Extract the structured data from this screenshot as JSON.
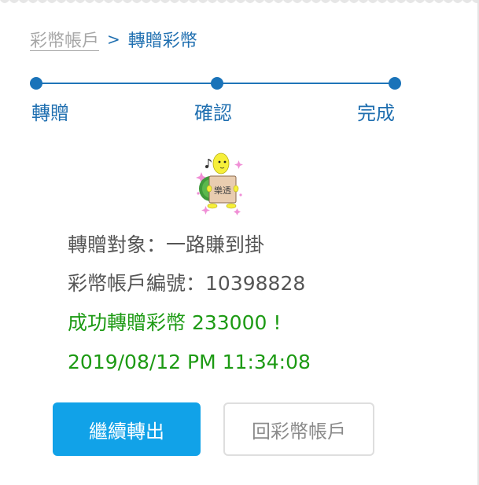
{
  "breadcrumb": {
    "parent": "彩幣帳戶",
    "separator": ">",
    "current": "轉贈彩幣"
  },
  "stepper": {
    "steps": [
      {
        "label": "轉贈"
      },
      {
        "label": "確認"
      },
      {
        "label": "完成"
      }
    ],
    "current_step": 3,
    "color": "#1a73b9"
  },
  "sticker": {
    "icon": "turtle-holding-sign-sticker",
    "sign_text": "樂透"
  },
  "result": {
    "recipient_label": "轉贈對象：",
    "recipient_name": "一路賺到掛",
    "account_label": "彩幣帳戶編號：",
    "account_number": "10398828",
    "success_message": "成功轉贈彩幣 233000 !",
    "timestamp": "2019/08/12 PM 11:34:08"
  },
  "actions": {
    "continue_label": "繼續轉出",
    "back_label": "回彩幣帳戶"
  },
  "colors": {
    "accent": "#11a2e8",
    "link": "#1f6fb0",
    "success": "#1c9a13",
    "text": "#555555"
  }
}
